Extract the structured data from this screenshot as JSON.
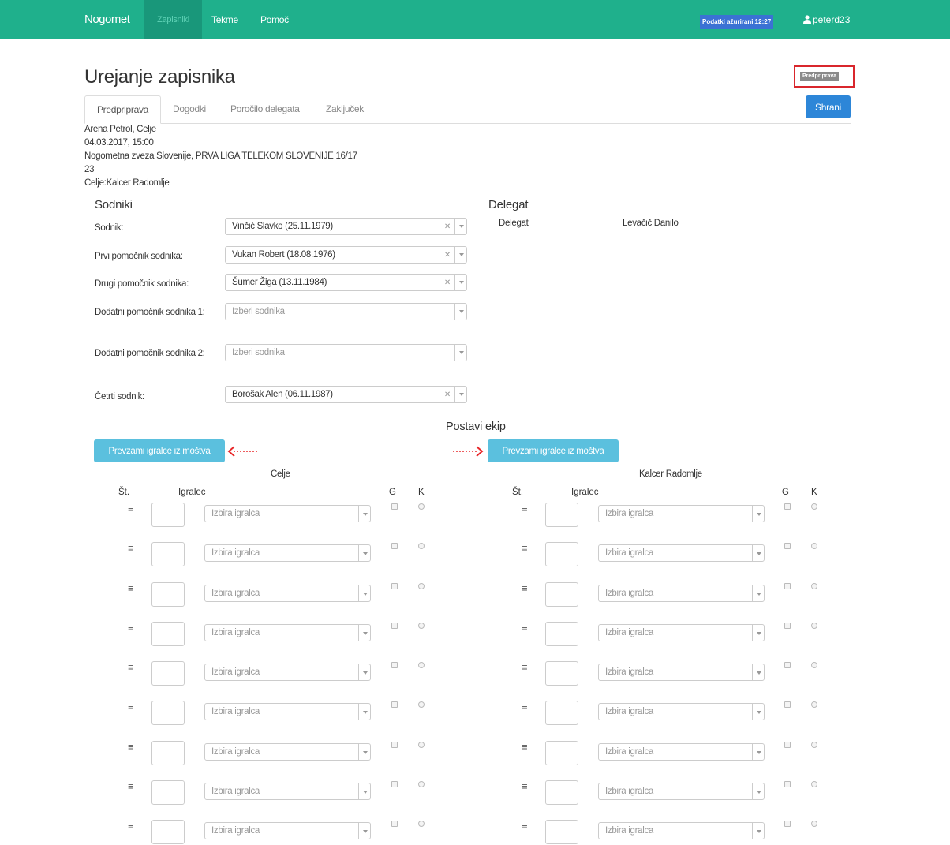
{
  "navbar": {
    "brand": "Nogomet",
    "items": [
      {
        "label": "Zapisniki",
        "active": true
      },
      {
        "label": "Tekme",
        "active": false
      },
      {
        "label": "Pomoč",
        "active": false
      }
    ],
    "status_badge": "Podatki ažurirani,12:27",
    "username": "peterd23",
    "color": "#1fb08c"
  },
  "page": {
    "title": "Urejanje zapisnika",
    "stage_label": "Predpriprava",
    "save_label": "Shrani"
  },
  "tabs": [
    "Predpriprava",
    "Dogodki",
    "Poročilo delegata",
    "Zaključek"
  ],
  "match_info": {
    "venue": "Arena Petrol, Celje",
    "datetime": "04.03.2017, 15:00",
    "competition": "Nogometna zveza Slovenije, PRVA LIGA TELEKOM SLOVENIJE 16/17",
    "round": "23",
    "teams": "Celje:Kalcer Radomlje"
  },
  "referees": {
    "title": "Sodniki",
    "rows": [
      {
        "label": "Sodnik:",
        "value": "Vinčić Slavko (25.11.1979)",
        "placeholder": ""
      },
      {
        "label": "Prvi pomočnik sodnika:",
        "value": "Vukan Robert (18.08.1976)",
        "placeholder": ""
      },
      {
        "label": "Drugi pomočnik sodnika:",
        "value": "Šumer Žiga (13.11.1984)",
        "placeholder": ""
      },
      {
        "label": "Dodatni pomočnik sodnika 1:",
        "value": "",
        "placeholder": "Izberi sodnika"
      },
      {
        "label": "Dodatni pomočnik sodnika 2:",
        "value": "",
        "placeholder": "Izberi sodnika"
      },
      {
        "label": "Četrti sodnik:",
        "value": "Borošak Alen (06.11.1987)",
        "placeholder": ""
      }
    ]
  },
  "delegate": {
    "title": "Delegat",
    "label": "Delegat",
    "name": "Levačič Danilo"
  },
  "lineup": {
    "title": "Postavi ekip",
    "button_label": "Prevzami igralce iz moštva",
    "columns": {
      "number": "Št.",
      "player": "Igralec",
      "goalkeeper": "G",
      "captain": "K"
    },
    "player_placeholder": "Izbira igralca",
    "home_team": "Celje",
    "away_team": "Kalcer Radomlje",
    "rows_per_team": 9
  },
  "colors": {
    "primary_button": "#2d86d8",
    "info_button": "#5bc0de",
    "highlight_border": "#d9262c",
    "arrow": "#e8292b"
  },
  "icons": [
    "user-icon",
    "drag-handle-icon",
    "chevron-down-icon",
    "clear-icon",
    "arrow-left-icon",
    "arrow-right-icon"
  ]
}
